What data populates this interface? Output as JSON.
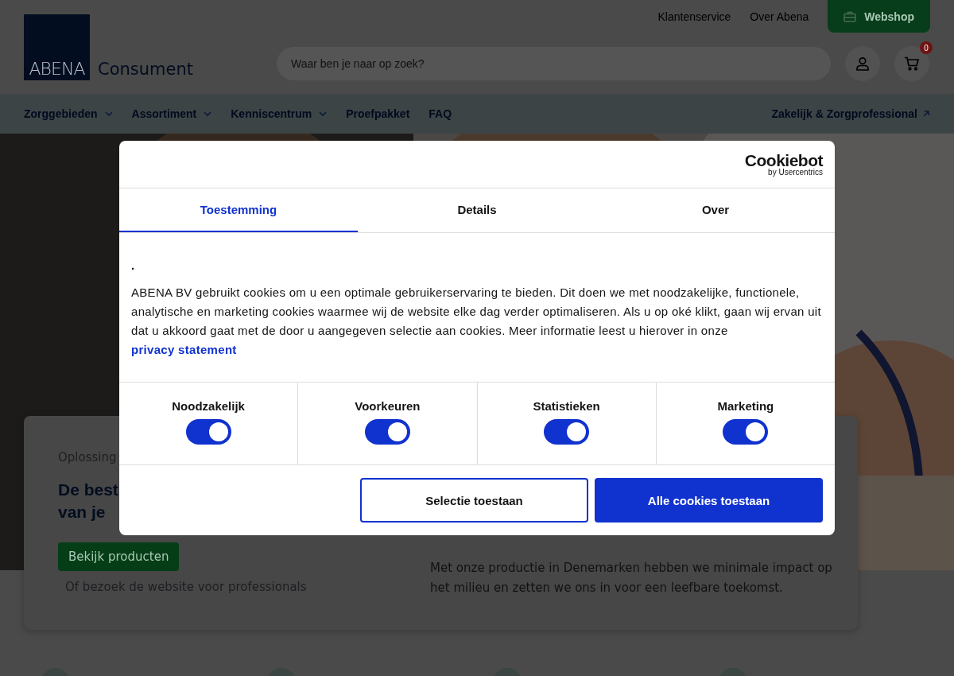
{
  "top_links": [
    "Klantenservice",
    "Over Abena"
  ],
  "webshop_button": "Webshop",
  "logo": {
    "mark": "ABENA",
    "name": "Consument"
  },
  "search": {
    "placeholder": "Waar ben je naar op zoek?"
  },
  "cart": {
    "count": "0"
  },
  "nav": [
    {
      "label": "Zorggebieden",
      "dropdown": true
    },
    {
      "label": "Assortiment",
      "dropdown": true
    },
    {
      "label": "Kenniscentrum",
      "dropdown": true
    },
    {
      "label": "Proefpakket",
      "dropdown": false
    },
    {
      "label": "FAQ",
      "dropdown": false
    }
  ],
  "nav_external": "Zakelijk & Zorgprofessional",
  "hero": {
    "kind": "picture"
  },
  "card": {
    "eyebrow": "Oplossing",
    "heading": [
      "De best",
      "van je"
    ],
    "button": "Bekijk producten",
    "link": "Of bezoek de website voor professionals",
    "body": [
      "Met onze productie in Denemarken hebben we minimale impact op",
      "het milieu en zetten we ons in voor een leefbare toekomst."
    ]
  },
  "dialog": {
    "brand": "Cookiebot",
    "brand_sub": "by Usercentrics",
    "tabs": [
      {
        "label": "Toestemming",
        "selected": true
      },
      {
        "label": "Details",
        "selected": false
      },
      {
        "label": "Over",
        "selected": false
      }
    ],
    "title": ".",
    "text": "ABENA BV gebruikt cookies om u een optimale gebruikerservaring te bieden. Dit doen we met noodzakelijke, functionele, analytische en marketing cookies waarmee wij de website elke dag verder optimaliseren. Als u op oké klikt, gaan wij ervan uit dat u akkoord gaat met de door u aangegeven selectie aan cookies. Meer informatie leest u hierover in onze",
    "link": "privacy statement",
    "categories": [
      {
        "label": "Noodzakelijk",
        "checked": true
      },
      {
        "label": "Voorkeuren",
        "checked": true
      },
      {
        "label": "Statistieken",
        "checked": true
      },
      {
        "label": "Marketing",
        "checked": true
      }
    ],
    "buttons": [
      "Selectie toestaan",
      "Alle cookies toestaan"
    ]
  }
}
